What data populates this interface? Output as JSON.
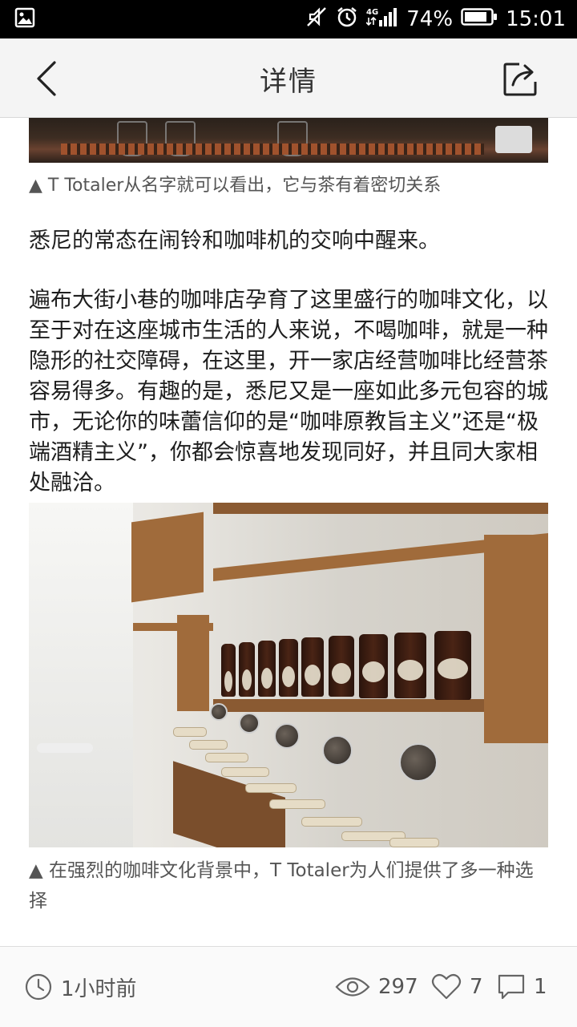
{
  "status_bar": {
    "battery": "74%",
    "time": "15:01",
    "network": "4G"
  },
  "header": {
    "title": "详情"
  },
  "article": {
    "caption_1": "▲ T Totaler从名字就可以看出，它与茶有着密切关系",
    "paragraph_1": "悉尼的常态在闹铃和咖啡机的交响中醒来。",
    "paragraph_2": "遍布大街小巷的咖啡店孕育了这里盛行的咖啡文化，以至于对在这座城市生活的人来说，不喝咖啡，就是一种隐形的社交障碍，在这里，开一家店经营咖啡比经营茶容易得多。有趣的是，悉尼又是一座如此多元包容的城市，无论你的味蕾信仰的是“咖啡原教旨主义”还是“极端酒精主义”，你都会惊喜地发现同好，并且同大家相处融洽。",
    "caption_2": "▲ 在强烈的咖啡文化背景中，T Totaler为人们提供了多一种选择"
  },
  "footer": {
    "time_ago": "1小时前",
    "views": "297",
    "likes": "7",
    "comments": "1"
  },
  "icons": {
    "image": "image-icon",
    "mute": "mute-icon",
    "alarm": "alarm-icon",
    "signal": "signal-icon",
    "battery": "battery-icon",
    "back": "chevron-left-icon",
    "share": "share-icon",
    "clock": "clock-icon",
    "eye": "eye-icon",
    "heart": "heart-icon",
    "comment": "comment-icon"
  }
}
